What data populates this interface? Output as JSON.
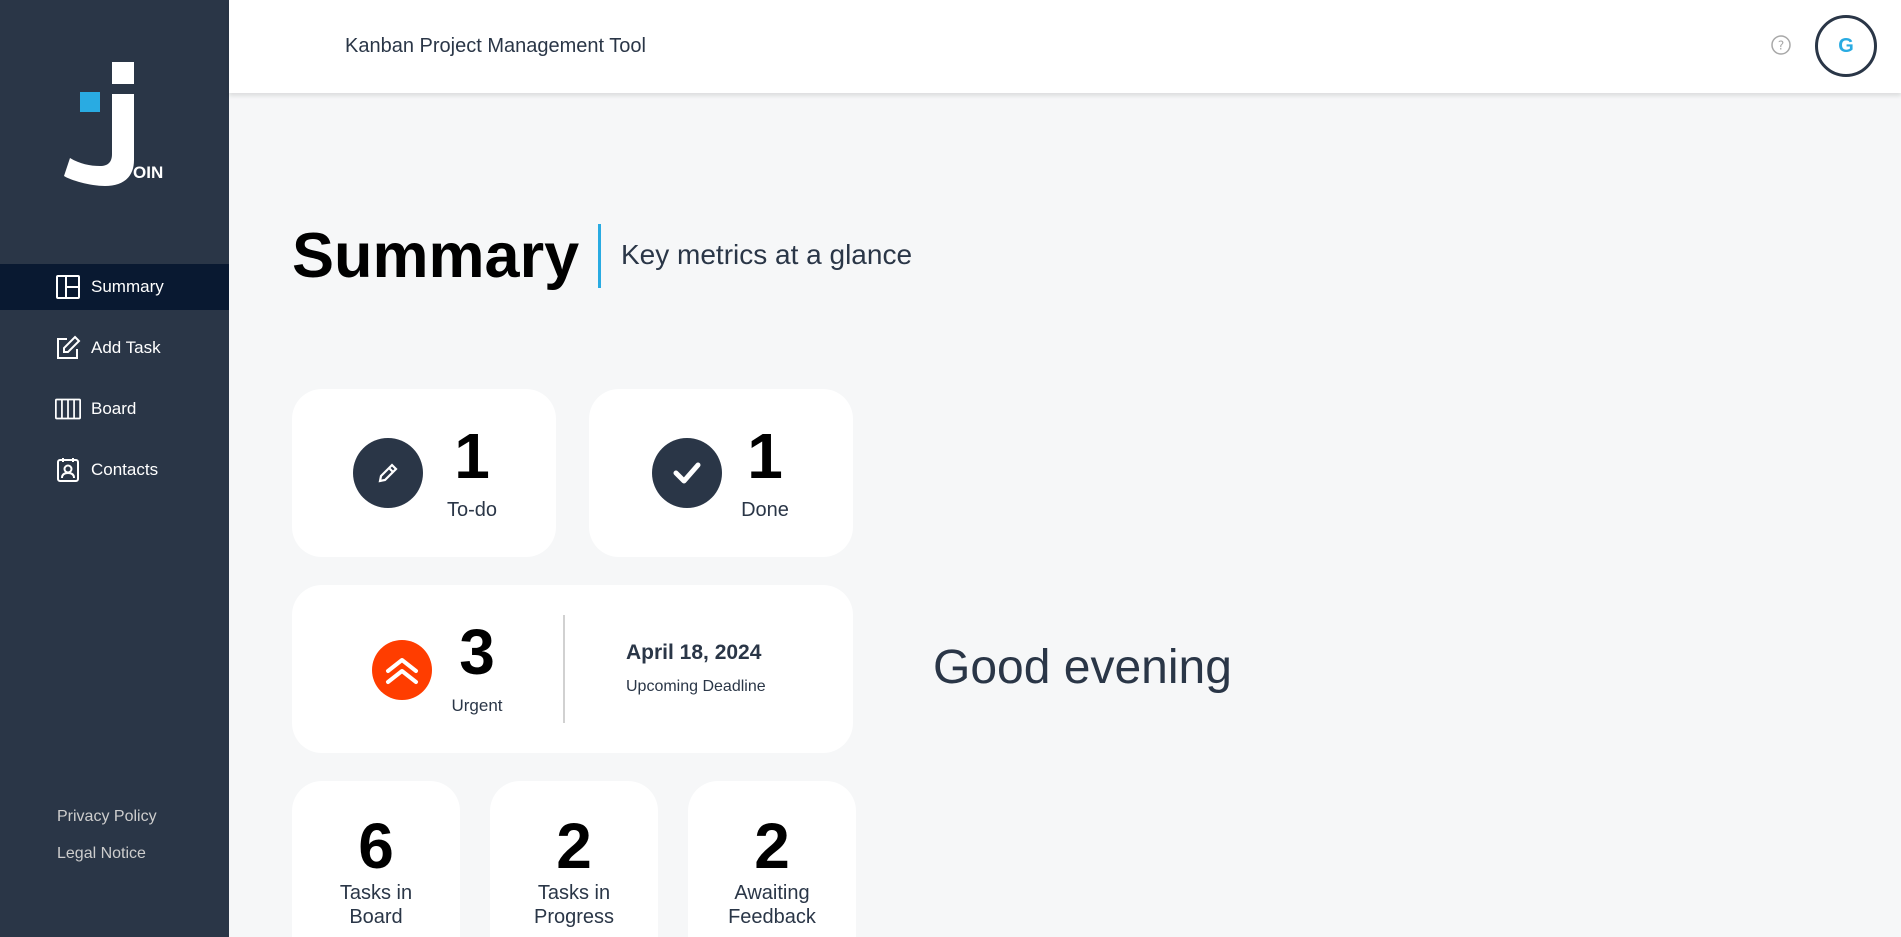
{
  "app": {
    "header_title": "Kanban Project Management Tool",
    "avatar_initial": "G"
  },
  "logo": {
    "text": "OIN"
  },
  "sidebar": {
    "items": [
      {
        "label": "Summary",
        "icon": "summary-icon",
        "active": true
      },
      {
        "label": "Add Task",
        "icon": "edit-icon",
        "active": false
      },
      {
        "label": "Board",
        "icon": "board-icon",
        "active": false
      },
      {
        "label": "Contacts",
        "icon": "contacts-icon",
        "active": false
      }
    ],
    "footer": {
      "privacy": "Privacy Policy",
      "legal": "Legal Notice"
    }
  },
  "summary": {
    "title": "Summary",
    "subtitle": "Key metrics at a glance",
    "todo": {
      "count": "1",
      "label": "To-do"
    },
    "done": {
      "count": "1",
      "label": "Done"
    },
    "urgent": {
      "count": "3",
      "label": "Urgent"
    },
    "deadline": {
      "date": "April 18, 2024",
      "label": "Upcoming Deadline"
    },
    "board": {
      "count": "6",
      "label_line1": "Tasks in",
      "label_line2": "Board"
    },
    "progress": {
      "count": "2",
      "label_line1": "Tasks in",
      "label_line2": "Progress"
    },
    "feedback": {
      "count": "2",
      "label_line1": "Awaiting",
      "label_line2": "Feedback"
    },
    "greeting": "Good evening"
  },
  "colors": {
    "sidebar": "#2A3647",
    "active_nav": "#091931",
    "accent": "#29ABE2",
    "urgent": "#FF3D00",
    "background": "#F6F7F8"
  }
}
